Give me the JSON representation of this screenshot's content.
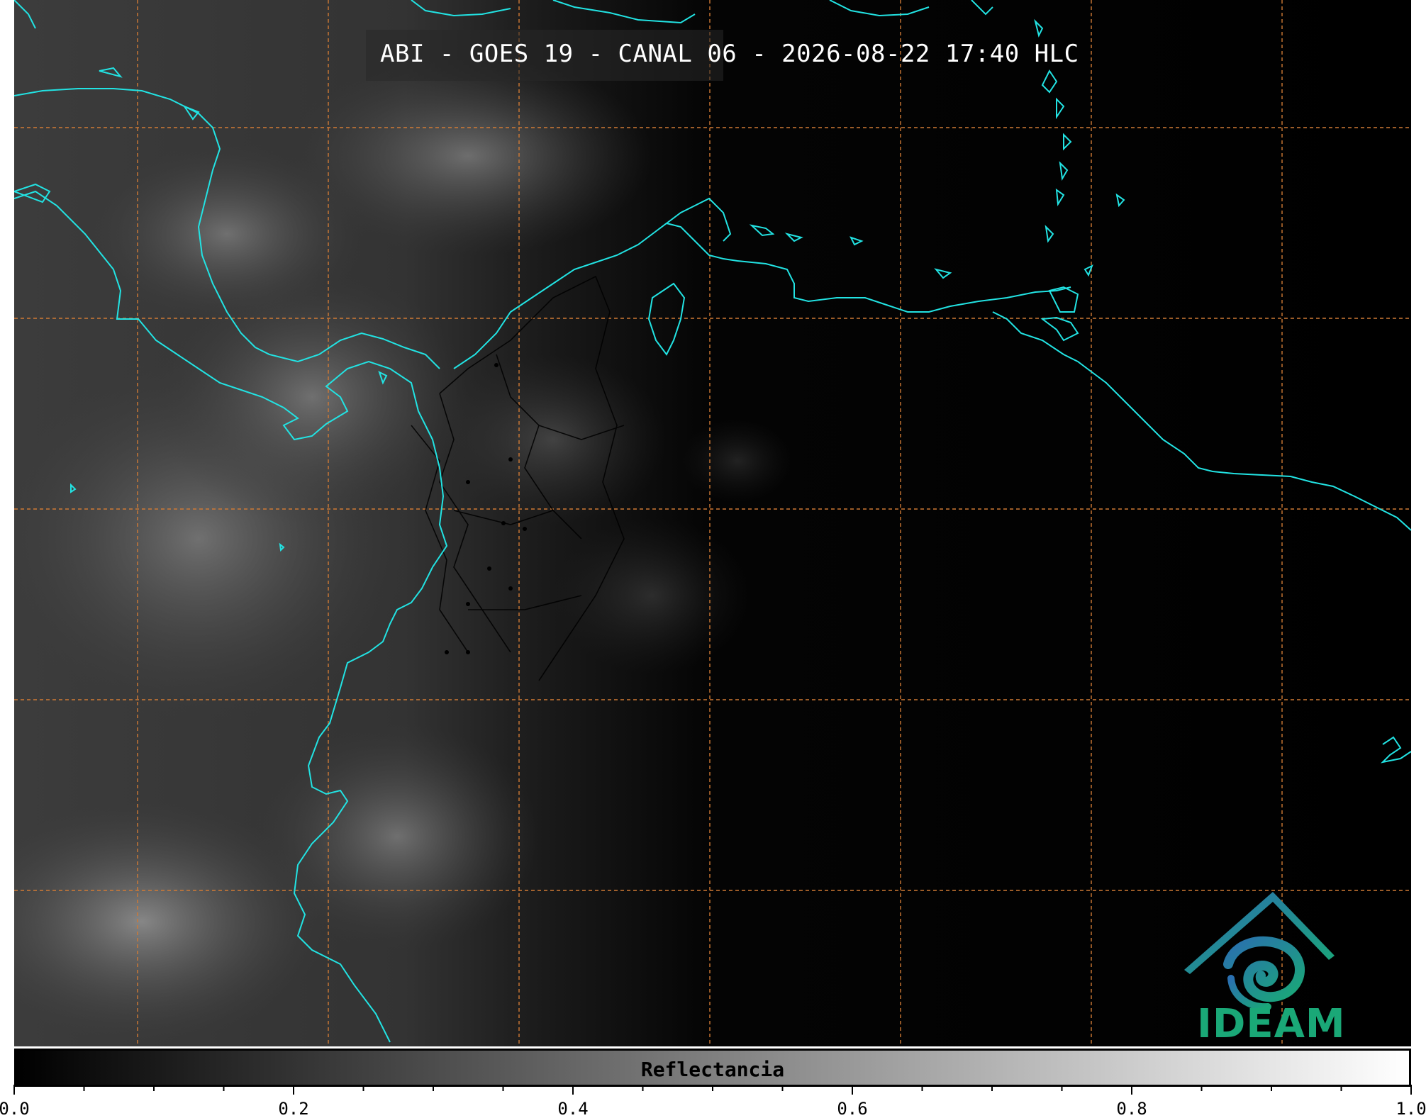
{
  "title": "ABI - GOES 19 - CANAL 06 - 2026-08-22 17:40 HLC",
  "colorbar": {
    "label": "Reflectancia",
    "min": 0.0,
    "max": 1.0,
    "tick_labels": [
      "0.0",
      "0.2",
      "0.4",
      "0.6",
      "0.8",
      "1.0"
    ],
    "colors": [
      "#000000",
      "#ffffff"
    ]
  },
  "logo": {
    "text": "IDEAM",
    "icon": "ideam-spiral-logo-icon"
  },
  "colors": {
    "coastline": "#22e3e3",
    "graticule": "#d07a35",
    "borders": "#000000",
    "logo_green": "#1aa877",
    "logo_blue": "#2a6fb0"
  }
}
